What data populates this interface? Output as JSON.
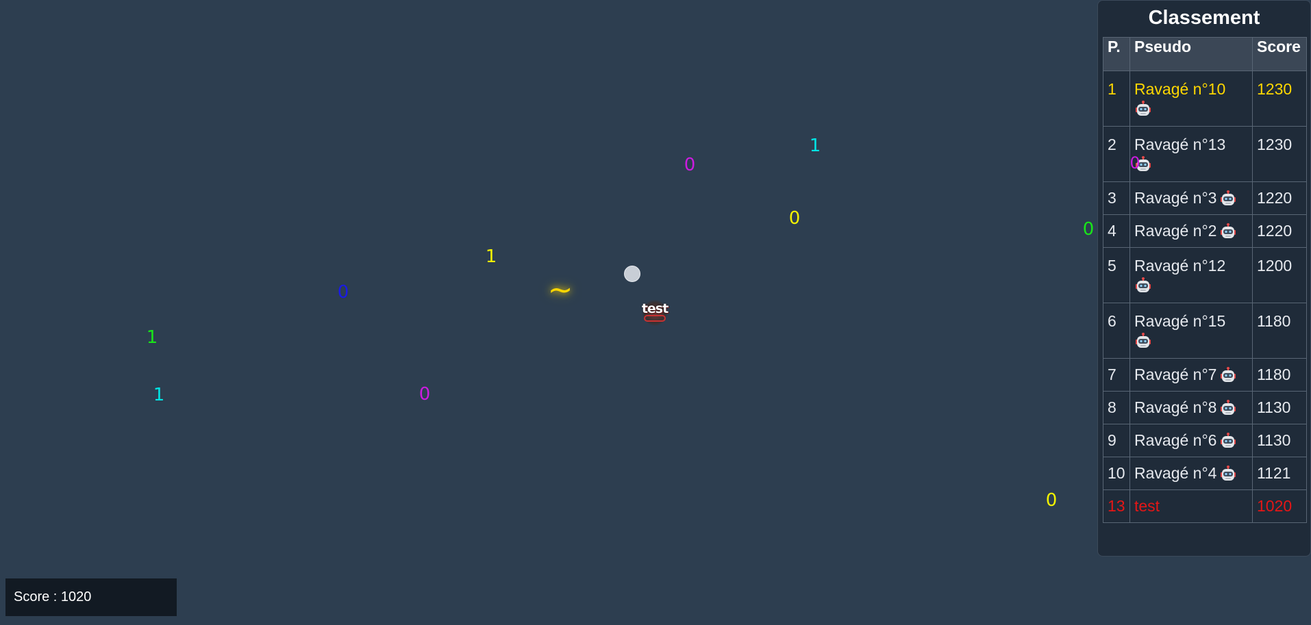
{
  "game": {
    "pellets": [
      {
        "text": "1",
        "color": "#00e5e5",
        "pos": "p1"
      },
      {
        "text": "0",
        "color": "#cc1ce0",
        "pos": "p2"
      },
      {
        "text": "0",
        "color": "#f2f200",
        "pos": "p3"
      },
      {
        "text": "0",
        "color": "#19e619",
        "pos": "p4"
      },
      {
        "text": "1",
        "color": "#f2f200",
        "pos": "p5"
      },
      {
        "text": "0",
        "color": "#1a1ae6",
        "pos": "p6"
      },
      {
        "text": "1",
        "color": "#19e619",
        "pos": "p7"
      },
      {
        "text": "1",
        "color": "#00e5e5",
        "pos": "p8"
      },
      {
        "text": "0",
        "color": "#cc1ce0",
        "pos": "p9"
      },
      {
        "text": "0",
        "color": "#f2f200",
        "pos": "p10"
      },
      {
        "text": "0",
        "color": "#cc1ce0",
        "pos": "p11"
      }
    ],
    "powerup_symbol": "~",
    "player_name": "test"
  },
  "leaderboard": {
    "title": "Classement",
    "headers": {
      "position": "P.",
      "pseudo": "Pseudo",
      "score": "Score"
    },
    "rows": [
      {
        "position": "1",
        "pseudo": "Ravagé n°10",
        "score": "1230",
        "bot": true,
        "variant": "gold"
      },
      {
        "position": "2",
        "pseudo": "Ravagé n°13",
        "score": "1230",
        "bot": true,
        "variant": "normal"
      },
      {
        "position": "3",
        "pseudo": "Ravagé n°3",
        "score": "1220",
        "bot": true,
        "variant": "normal"
      },
      {
        "position": "4",
        "pseudo": "Ravagé n°2",
        "score": "1220",
        "bot": true,
        "variant": "normal"
      },
      {
        "position": "5",
        "pseudo": "Ravagé n°12",
        "score": "1200",
        "bot": true,
        "variant": "normal"
      },
      {
        "position": "6",
        "pseudo": "Ravagé n°15",
        "score": "1180",
        "bot": true,
        "variant": "normal"
      },
      {
        "position": "7",
        "pseudo": "Ravagé n°7",
        "score": "1180",
        "bot": true,
        "variant": "normal"
      },
      {
        "position": "8",
        "pseudo": "Ravagé n°8",
        "score": "1130",
        "bot": true,
        "variant": "normal"
      },
      {
        "position": "9",
        "pseudo": "Ravagé n°6",
        "score": "1130",
        "bot": true,
        "variant": "normal"
      },
      {
        "position": "10",
        "pseudo": "Ravagé n°4",
        "score": "1121",
        "bot": true,
        "variant": "normal"
      },
      {
        "position": "13",
        "pseudo": "test",
        "score": "1020",
        "bot": false,
        "variant": "me"
      }
    ],
    "bot_icon": "robot-icon"
  },
  "hud": {
    "score_label": "Score : 1020"
  }
}
